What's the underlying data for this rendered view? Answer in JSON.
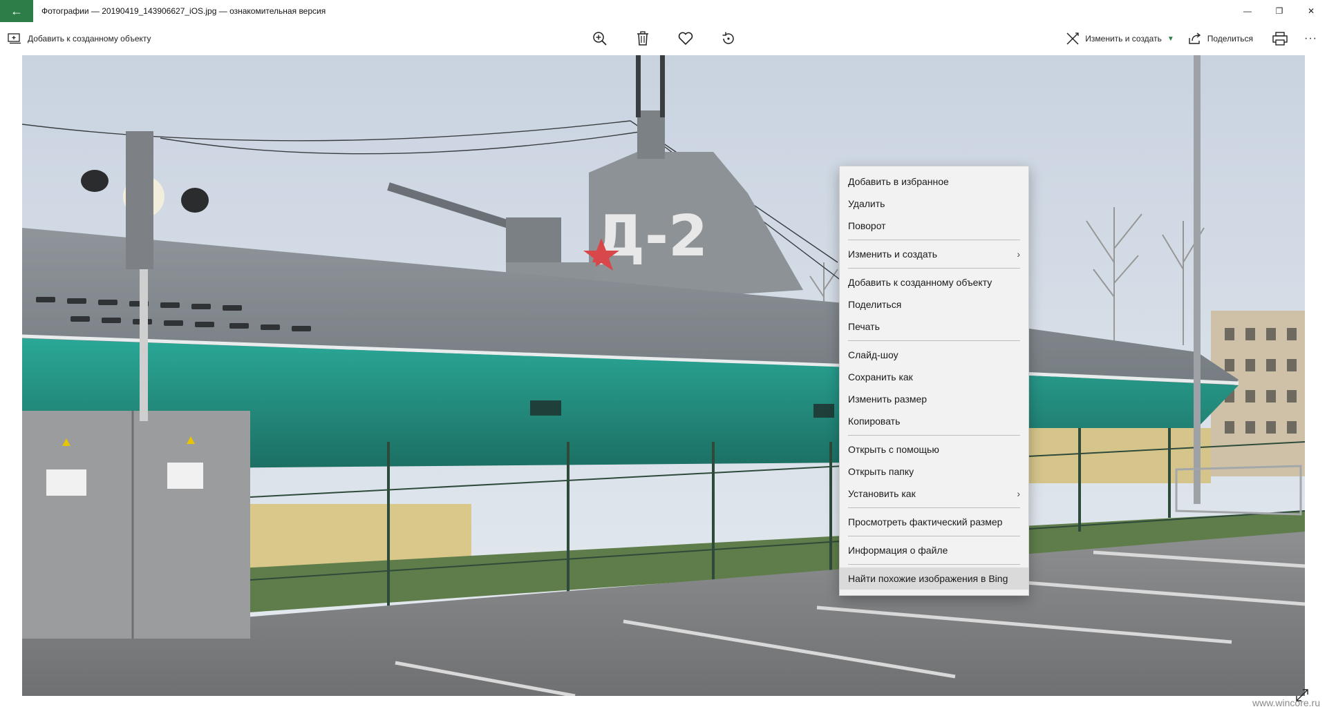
{
  "window": {
    "title": "Фотографии — 20190419_143906627_iOS.jpg — ознакомительная версия",
    "controls": {
      "minimize": "—",
      "restore": "❐",
      "close": "✕"
    }
  },
  "toolbar": {
    "add_to_creation": "Добавить к созданному объекту",
    "edit_create": "Изменить и создать",
    "share": "Поделиться",
    "more": "···"
  },
  "photo": {
    "hull_text": "Д-2"
  },
  "context_menu": {
    "items": [
      "Добавить в избранное",
      "Удалить",
      "Поворот",
      "Изменить и создать",
      "Добавить к созданному объекту",
      "Поделиться",
      "Печать",
      "Слайд-шоу",
      "Сохранить как",
      "Изменить размер",
      "Копировать",
      "Открыть с помощью",
      "Открыть папку",
      "Установить как",
      "Просмотреть фактический размер",
      "Информация о файле",
      "Найти похожие изображения в Bing"
    ],
    "submenu_arrow": "›"
  },
  "watermark": "www.wincore.ru",
  "colors": {
    "accent": "#2d7d46",
    "menu_bg": "#f2f2f2",
    "menu_highlight": "#dadada"
  }
}
